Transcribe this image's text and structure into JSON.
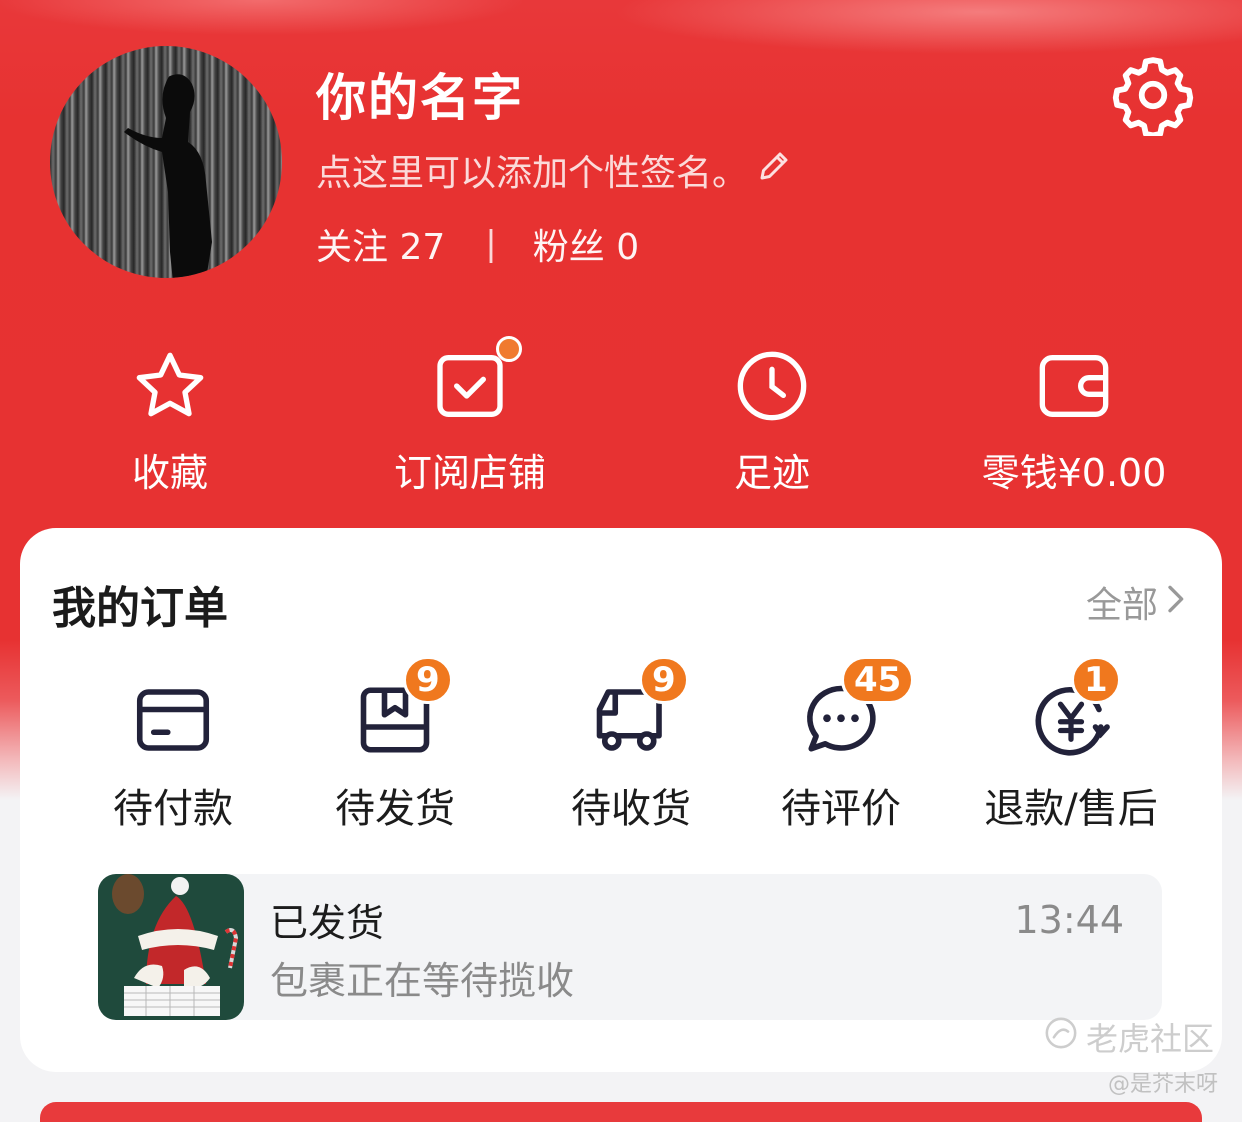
{
  "profile": {
    "name": "你的名字",
    "signature": "点这里可以添加个性签名。",
    "following_label": "关注",
    "following_count": "27",
    "separator": "|",
    "followers_label": "粉丝",
    "followers_count": "0"
  },
  "quick_actions": [
    {
      "label": "收藏",
      "icon": "star-icon"
    },
    {
      "label": "订阅店铺",
      "icon": "subscribe-shop-icon"
    },
    {
      "label": "足迹",
      "icon": "clock-icon"
    },
    {
      "label": "零钱¥0.00",
      "icon": "wallet-icon"
    }
  ],
  "orders_card": {
    "title": "我的订单",
    "all_label": "全部"
  },
  "order_statuses": [
    {
      "label": "待付款",
      "icon": "card-icon",
      "badge": ""
    },
    {
      "label": "待发货",
      "icon": "box-icon",
      "badge": "9"
    },
    {
      "label": "待收货",
      "icon": "truck-icon",
      "badge": "9"
    },
    {
      "label": "待评价",
      "icon": "chat-bubble-icon",
      "badge": "45"
    },
    {
      "label": "退款/售后",
      "icon": "refund-icon",
      "badge": "1"
    }
  ],
  "shipment": {
    "status": "已发货",
    "description": "包裹正在等待揽收",
    "time": "13:44"
  },
  "watermark": {
    "brand": "老虎社区",
    "author": "@是芥末呀"
  },
  "colors": {
    "primary": "#e73232",
    "badge": "#f0781e",
    "card": "#ffffff"
  }
}
